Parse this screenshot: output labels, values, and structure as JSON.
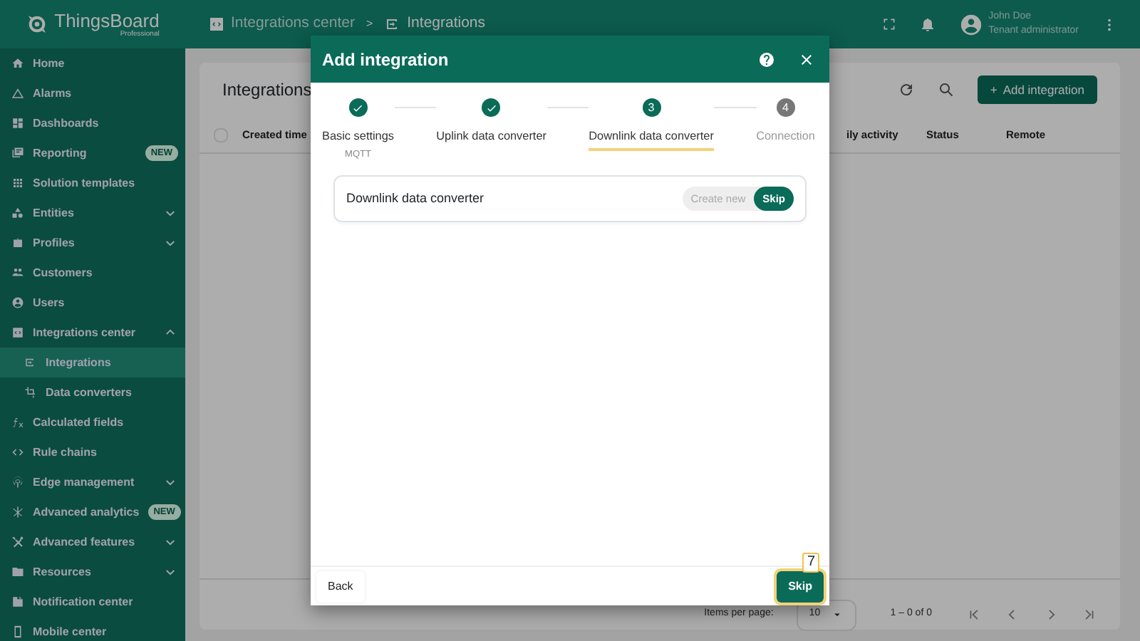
{
  "header": {
    "logo_title": "ThingsBoard",
    "logo_subtitle": "Professional",
    "breadcrumbs": [
      {
        "label": "Integrations center"
      },
      {
        "label": "Integrations"
      }
    ],
    "breadcrumb_separator": ">",
    "user": {
      "name": "John Doe",
      "role": "Tenant administrator"
    }
  },
  "sidebar": {
    "items": [
      {
        "label": "Home",
        "selected": false
      },
      {
        "label": "Alarms",
        "selected": false
      },
      {
        "label": "Dashboards",
        "selected": false
      },
      {
        "label": "Reporting",
        "badge": "NEW",
        "selected": false
      },
      {
        "label": "Solution templates",
        "selected": false
      },
      {
        "label": "Entities",
        "expanded": false,
        "selected": false
      },
      {
        "label": "Profiles",
        "expanded": false,
        "selected": false
      },
      {
        "label": "Customers",
        "selected": false
      },
      {
        "label": "Users",
        "selected": false
      },
      {
        "label": "Integrations center",
        "expanded": true,
        "selected": false,
        "children": [
          {
            "label": "Integrations",
            "selected": true
          },
          {
            "label": "Data converters",
            "selected": false
          }
        ]
      },
      {
        "label": "Calculated fields",
        "selected": false
      },
      {
        "label": "Rule chains",
        "selected": false
      },
      {
        "label": "Edge management",
        "expanded": false,
        "selected": false
      },
      {
        "label": "Advanced analytics",
        "badge": "NEW",
        "selected": false
      },
      {
        "label": "Advanced features",
        "expanded": false,
        "selected": false
      },
      {
        "label": "Resources",
        "expanded": false,
        "selected": false
      },
      {
        "label": "Notification center",
        "selected": false
      },
      {
        "label": "Mobile center",
        "selected": false
      }
    ]
  },
  "page": {
    "title": "Integrations",
    "add_button": "Add integration",
    "add_button_icon": "+",
    "table": {
      "columns": [
        {
          "label": "Created time"
        },
        {
          "label": "ily activity"
        },
        {
          "label": "Status"
        },
        {
          "label": "Remote"
        }
      ],
      "select_all_checked": false
    },
    "paginator": {
      "items_per_page_label": "Items per page:",
      "page_size": "10",
      "range": "1 – 0 of 0"
    }
  },
  "dialog": {
    "title": "Add integration",
    "steps": [
      {
        "label": "Basic settings",
        "sublabel": "MQTT",
        "completed": true,
        "selected": false
      },
      {
        "label": "Uplink data converter",
        "completed": true,
        "selected": false
      },
      {
        "number": "3",
        "label": "Downlink data converter",
        "completed": false,
        "selected": true
      },
      {
        "number": "4",
        "label": "Connection",
        "completed": false,
        "selected": false
      }
    ],
    "section": {
      "label": "Downlink data converter",
      "options": [
        {
          "label": "Create new",
          "selected": false
        },
        {
          "label": "Skip",
          "selected": true
        }
      ]
    },
    "back_button": "Back",
    "next_button": "Skip",
    "callout": "7"
  }
}
